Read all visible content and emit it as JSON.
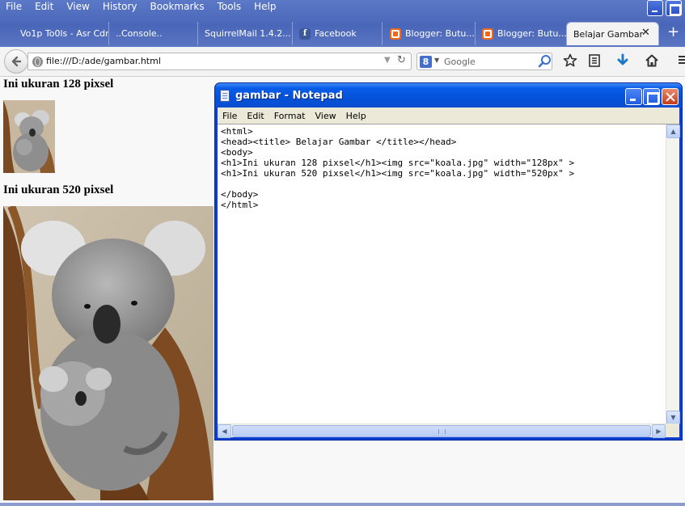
{
  "browser": {
    "menu": [
      "File",
      "Edit",
      "View",
      "History",
      "Bookmarks",
      "Tools",
      "Help"
    ],
    "tabs": [
      {
        "label": "Vo1p To0ls - Asr Cdr"
      },
      {
        "label": "..Console.."
      },
      {
        "label": "SquirrelMail 1.4.2..."
      },
      {
        "label": "Facebook"
      },
      {
        "label": "Blogger: Butu..."
      },
      {
        "label": "Blogger: Butu..."
      },
      {
        "label": "Belajar Gambar"
      }
    ],
    "url": "file:///D:/ade/gambar.html",
    "search_placeholder": "Google"
  },
  "page": {
    "heading_small": "Ini ukuran 128 pixsel",
    "heading_large": "Ini ukuran 520 pixsel",
    "image_alt": "koala.jpg"
  },
  "notepad": {
    "title": "gambar - Notepad",
    "menu": [
      "File",
      "Edit",
      "Format",
      "View",
      "Help"
    ],
    "content": "<html>\n<head><title> Belajar Gambar </title></head>\n<body>\n<h1>Ini ukuran 128 pixsel</h1><img src=\"koala.jpg\" width=\"128px\" >\n<h1>Ini ukuran 520 pixsel</h1><img src=\"koala.jpg\" width=\"520px\" >\n\n</body>\n</html>"
  },
  "colors": {
    "xp_title_blue": "#0a5ce8",
    "firefox_chrome_blue": "#4a66b8",
    "close_red": "#c33d1b"
  }
}
